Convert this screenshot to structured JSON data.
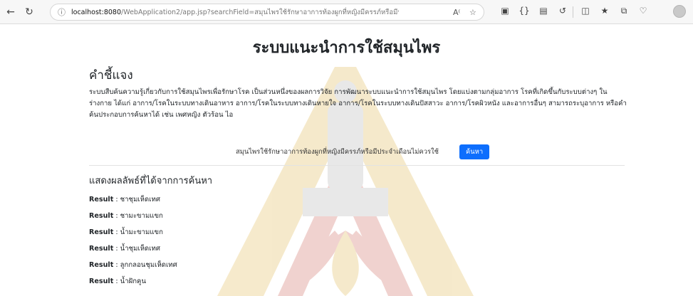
{
  "browser": {
    "url_host": "localhost:8080",
    "url_rest": "/WebApplication2/app.jsp?searchField=สมุนไพรใช้รักษาอาการท้องผูกที่หญิงมีครรภ์หรือมีประจำเดือนไม่ควรใช้"
  },
  "page": {
    "title": "ระบบแนะนำการใช้สมุนไพร",
    "instructions_heading": "คำชี้แจง",
    "instructions_text": "ระบบสืบค้นความรู้เกี่ยวกับการใช้สมุนไพรเพื่อรักษาโรค เป็นส่วนหนึ่งของผลการวิจัย การพัฒนาระบบแนะนำการใช้สมุนไพร โดยแบ่งตามกลุ่มอาการ โรคที่เกิดขึ้นกับระบบต่างๆ ในร่างกาย ได้แก่ อาการ/โรคในระบบทางเดินอาหาร อาการ/โรคในระบบทางเดินหายใจ อาการ/โรคในระบบทางเดินปัสสาวะ อาการ/โรคผิวหนัง และอาการอื่นๆ สามารถระบุอาการ หรือคำค้นประกอบการค้นหาได้ เช่น เพศหญิง ตัวร้อน ไอ"
  },
  "search": {
    "value": "สมุนไพรใช้รักษาอาการท้องผูกที่หญิงมีครรภ์หรือมีประจำเดือนไม่ควรใช้",
    "button_label": "ค้นหา"
  },
  "results": {
    "heading": "แสดงผลลัพธ์ที่ได้จากการค้นหา",
    "label": "Result",
    "items": [
      ": ชาชุมเห็ดเทศ",
      ": ชามะขามแขก",
      ": น้ำมะขามแขก",
      ": น้ำชุมเห็ดเทศ",
      ": ลูกกลอนชุมเห็ดเทศ",
      ": น้ำฝักคูน"
    ]
  },
  "colors": {
    "accent": "#0d6efd",
    "watermark_red": "#c0392b",
    "watermark_gold": "#d4a017",
    "watermark_gray": "#9a9a9a"
  }
}
